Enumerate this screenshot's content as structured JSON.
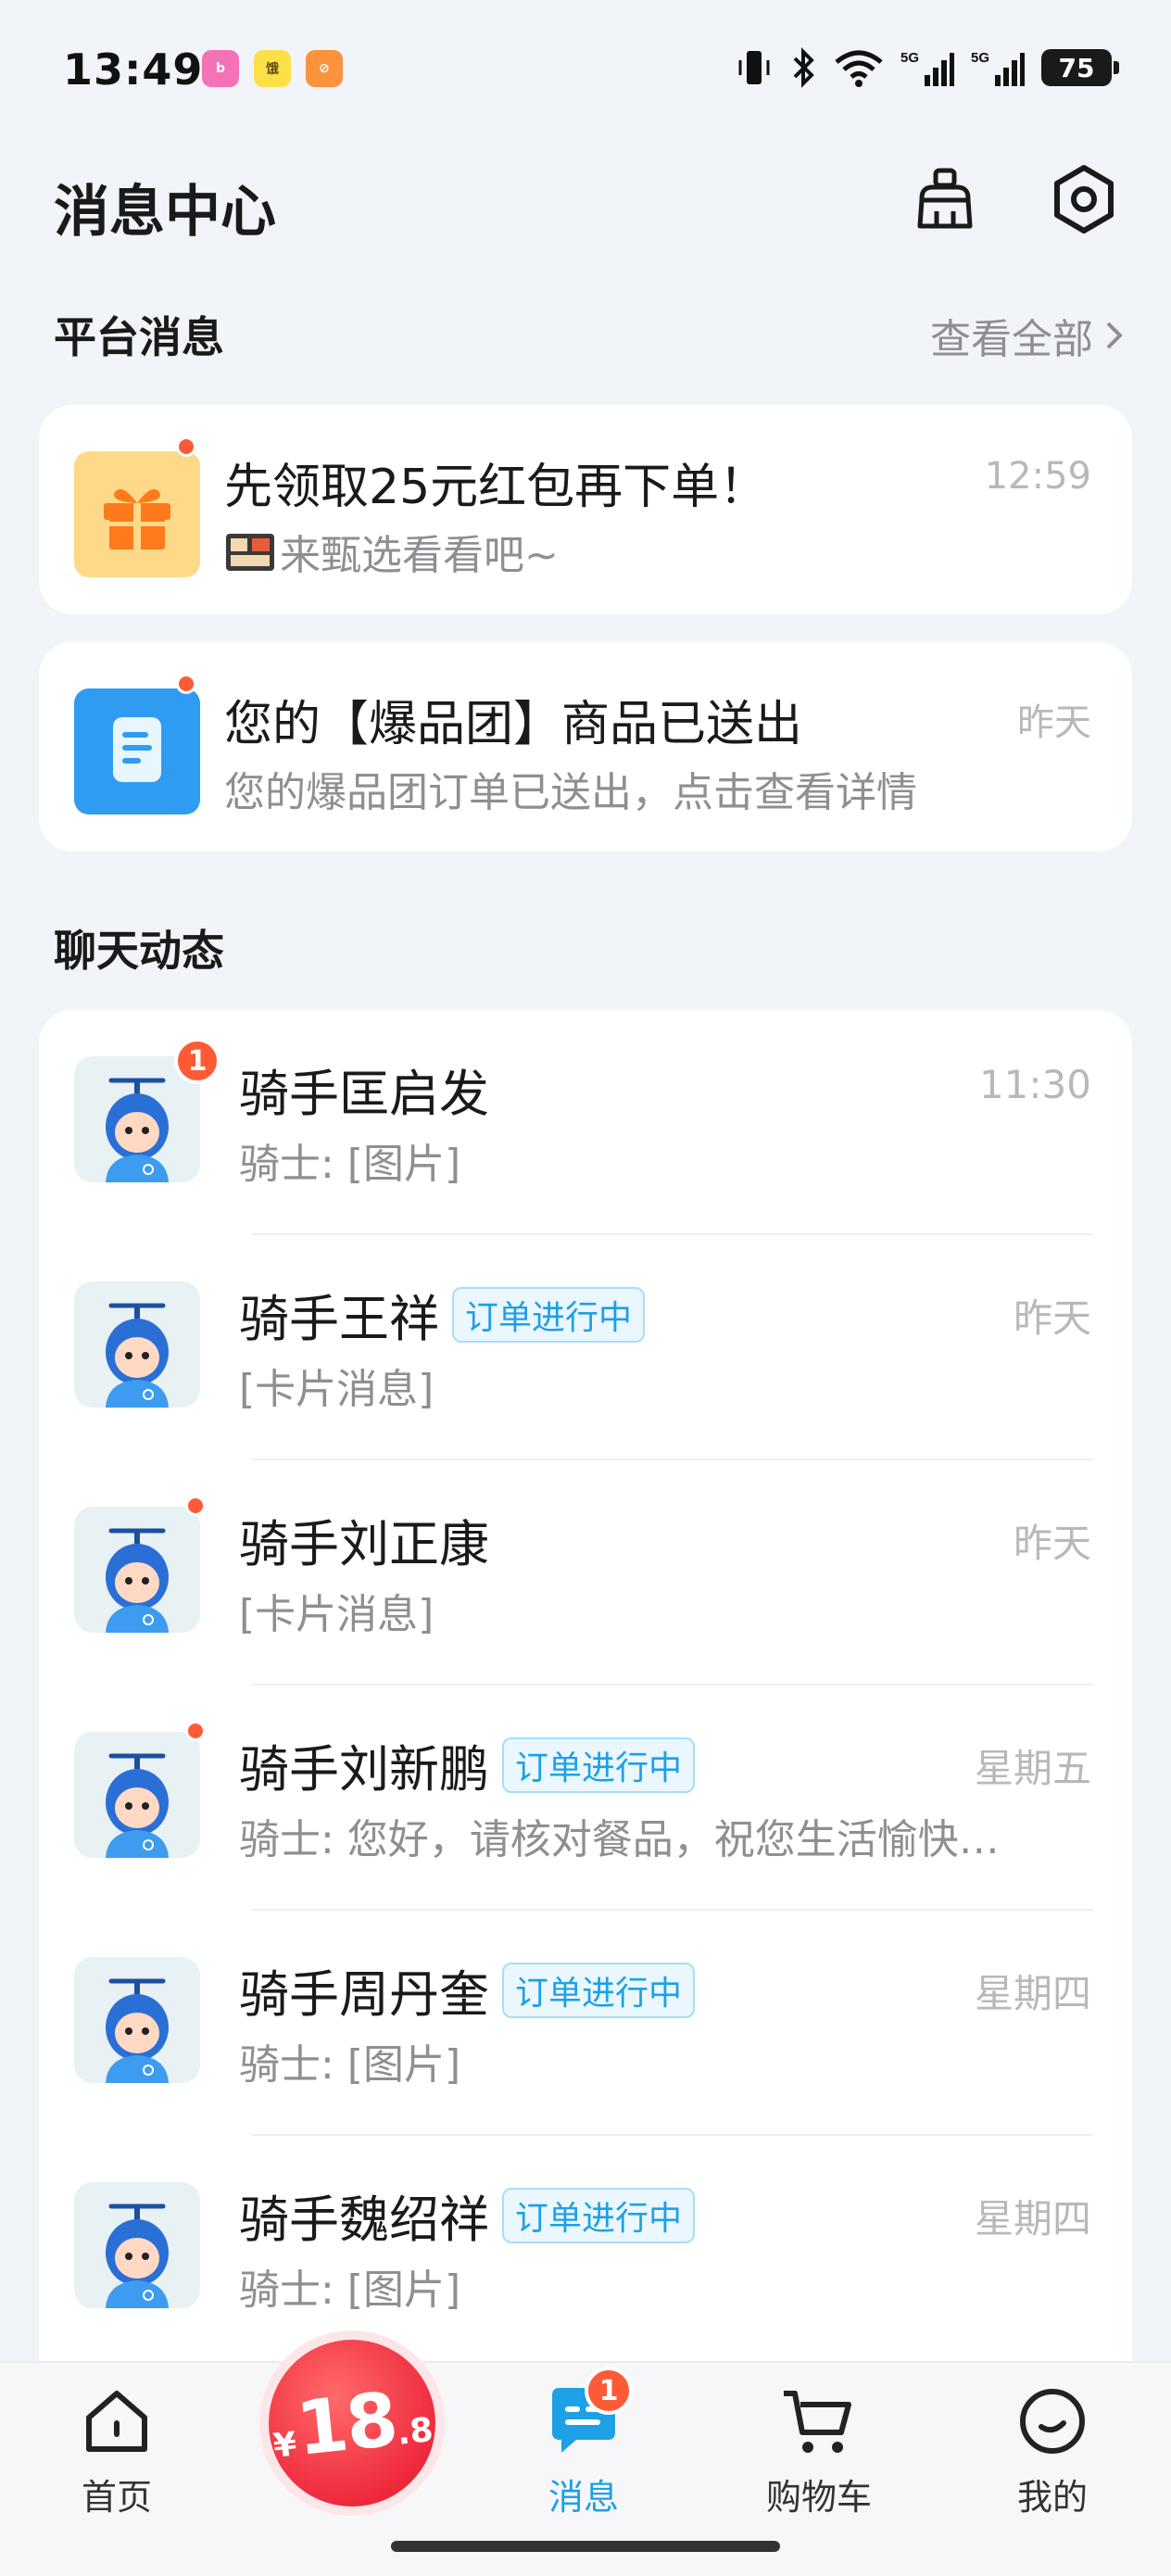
{
  "status_bar": {
    "time": "13:49",
    "app_icons": [
      "bilibili",
      "eleme",
      "cancel"
    ],
    "network_1": "5G",
    "network_2": "5G",
    "battery": "75"
  },
  "header": {
    "title": "消息中心",
    "broom_icon": "broom-icon",
    "settings_icon": "hexagon-settings-icon"
  },
  "platform": {
    "section_title": "平台消息",
    "see_all": "查看全部",
    "items": [
      {
        "title": "先领取25元红包再下单！",
        "subtitle": "来甄选看看吧~",
        "time": "12:59",
        "icon": "gift-icon",
        "icon_bg": "#ffd98a"
      },
      {
        "title": "您的【爆品团】商品已送出",
        "subtitle": "您的爆品团订单已送出，点击查看详情",
        "time": "昨天",
        "icon": "document-icon",
        "icon_bg": "#2f9cf2"
      }
    ]
  },
  "chats": {
    "section_title": "聊天动态",
    "items": [
      {
        "name": "骑手匡启发",
        "tag": "",
        "preview": "骑士: [图片]",
        "time": "11:30",
        "badge": "1"
      },
      {
        "name": "骑手王祥",
        "tag": "订单进行中",
        "preview": "[卡片消息]",
        "time": "昨天",
        "badge": ""
      },
      {
        "name": "骑手刘正康",
        "tag": "",
        "preview": "[卡片消息]",
        "time": "昨天",
        "badge": "dot"
      },
      {
        "name": "骑手刘新鹏",
        "tag": "订单进行中",
        "preview": "骑士: 您好，请核对餐品，祝您生活愉快…",
        "time": "星期五",
        "badge": "dot"
      },
      {
        "name": "骑手周丹奎",
        "tag": "订单进行中",
        "preview": "骑士: [图片]",
        "time": "星期四",
        "badge": ""
      },
      {
        "name": "骑手魏绍祥",
        "tag": "订单进行中",
        "preview": "骑士: [图片]",
        "time": "星期四",
        "badge": ""
      }
    ]
  },
  "bottom_nav": {
    "home": "首页",
    "promo_yen": "¥",
    "promo_int": "18",
    "promo_dec": ".8",
    "messages": "消息",
    "messages_badge": "1",
    "cart": "购物车",
    "me": "我的",
    "active_color": "#1ea0e6"
  }
}
